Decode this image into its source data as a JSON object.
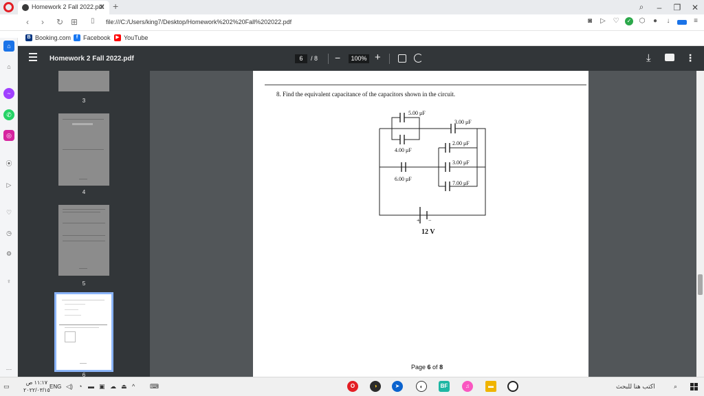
{
  "browser": {
    "tab_title": "Homework 2 Fall 2022.pdf",
    "tab_close": "✕",
    "new_tab": "+",
    "url": "file:///C:/Users/king7/Desktop/Homework%202%20Fall%202022.pdf",
    "bookmarks": [
      {
        "label": "Booking.com",
        "icon_color": "#003580",
        "icon_text": "B"
      },
      {
        "label": "Facebook",
        "icon_color": "#1877f2",
        "icon_text": "f"
      },
      {
        "label": "YouTube",
        "icon_color": "#ff0000",
        "icon_text": "▶"
      }
    ]
  },
  "pdf": {
    "title": "Homework 2 Fall 2022.pdf",
    "current_page": "6",
    "total_pages": "/ 8",
    "zoom": "100%",
    "zoom_out": "−",
    "zoom_in": "+",
    "thumbnails": [
      {
        "number": "3"
      },
      {
        "number": "4"
      },
      {
        "number": "5"
      },
      {
        "number": "6"
      }
    ],
    "page": {
      "question": "8.   Find the equivalent capacitance of the capacitors shown in the circuit.",
      "capacitors": {
        "c1": "5.00 μF",
        "c2": "3.00 μF",
        "c3": "4.00 μF",
        "c4": "2.00 μF",
        "c5": "3.00 μF",
        "c6": "6.00 μF",
        "c7": "7.00 μF"
      },
      "battery": "12 V",
      "battery_plus": "+",
      "battery_minus": "−",
      "footer_prefix": "Page ",
      "footer_current": "6",
      "footer_mid": " of ",
      "footer_total": "8"
    }
  },
  "taskbar": {
    "time": "١١:١٧ ص",
    "date": "٢٠٢٢/٠٣/١٥",
    "language": "ENG",
    "search_placeholder": "اكتب هنا للبحث"
  }
}
